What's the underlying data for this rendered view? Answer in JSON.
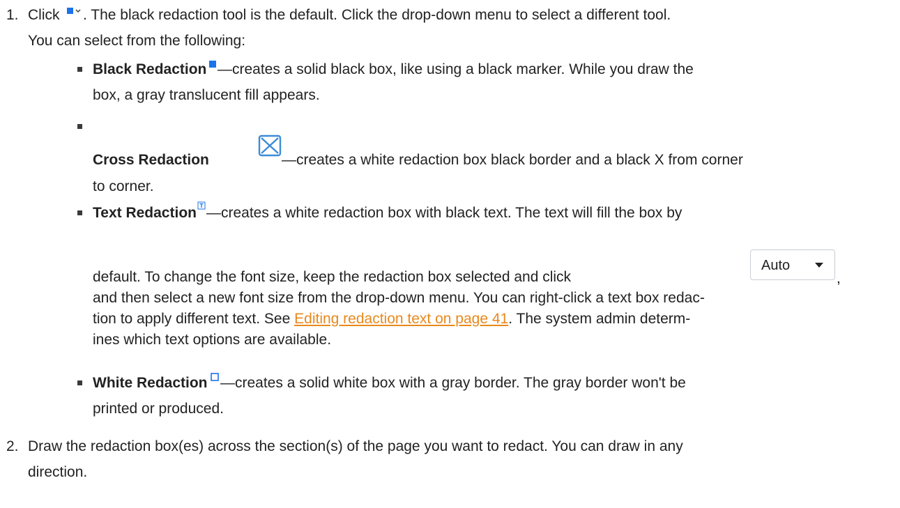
{
  "step1": {
    "number": "1.",
    "line1_a": "Click",
    "line1_b": ". The black redaction tool is the default. Click the drop-down menu to select a different tool.",
    "line2": "You can select from the following:",
    "click_icon": "black-redaction-dropdown-icon"
  },
  "bullets": [
    {
      "title": "Black Redaction",
      "icon": "black-redaction-icon",
      "line1": "—creates a solid black box, like using a black marker. While you draw the",
      "line2": "box, a gray translucent fill appears."
    },
    {
      "title": "Cross Redaction",
      "icon": "cross-redaction-icon",
      "line1": "—creates a white redaction box black border and a black X from corner",
      "line2": "to corner."
    },
    {
      "title": "Text Redaction",
      "icon": "text-redaction-icon",
      "line1": "—creates a white redaction box with black text. The text will fill the box by",
      "line2": "default. To change the font size, keep the redaction box selected and click",
      "line2_end": ",",
      "line3": "and then select a new font size from the drop-down menu. You can right-click a text box redac-",
      "line4_a": "tion to apply different text. See ",
      "line4_link": "Editing redaction text on page 41",
      "line4_b": ". The system admin determ-",
      "line5": "ines which text options are available.",
      "font_size_select": {
        "value": "Auto"
      }
    },
    {
      "title": "White Redaction",
      "icon": "white-redaction-icon",
      "line1": "—creates a solid white box with a gray border. The gray border won't be",
      "line2": "printed or produced."
    }
  ],
  "step2": {
    "number": "2.",
    "line1": "Draw the redaction box(es) across the section(s) of the page you want to redact. You can draw in any",
    "line2": "direction."
  },
  "colors": {
    "text": "#222222",
    "link": "#e8891b",
    "icon_blue": "#1a73e8",
    "cross_icon": "#3d8bd6"
  }
}
